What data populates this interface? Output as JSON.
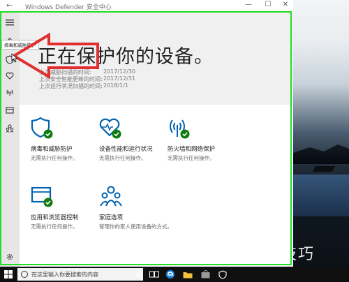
{
  "window": {
    "title": "Windows Defender 安全中心",
    "back_glyph": "←",
    "minimize_glyph": "—",
    "maximize_glyph": "☐",
    "close_glyph": "✕"
  },
  "tooltip": "病毒和威胁防护",
  "hero": {
    "title": "正在保护你的设备。",
    "lines": [
      {
        "label": "上次威胁扫描的时间:",
        "date": "2017/12/30"
      },
      {
        "label": "上次安全智能更新的时间:",
        "date": "2017/12/31"
      },
      {
        "label": "上次运行状况扫描的时间:",
        "date": "2018/1/1"
      }
    ]
  },
  "tiles": [
    {
      "icon": "shield-check-icon",
      "name": "病毒和威胁防护",
      "status": "无需执行任何操作。"
    },
    {
      "icon": "heart-check-icon",
      "name": "设备性能和运行状况",
      "status": "无需执行任何操作。"
    },
    {
      "icon": "wifi-check-icon",
      "name": "防火墙和网络保护",
      "status": "无需执行任何操作。"
    },
    {
      "icon": "browser-check-icon",
      "name": "应用和浏览器控制",
      "status": "无需执行任何操作。"
    },
    {
      "icon": "family-icon",
      "name": "家庭选项",
      "status": "管理你的家人使用设备的方式。"
    }
  ],
  "taskbar": {
    "search_placeholder": "在这里输入你要搜索的内容"
  },
  "watermark": "软件技巧",
  "colors": {
    "accent": "#0063b1",
    "check_green": "#107c10",
    "highlight": "#22dd22",
    "arrow": "#e03030"
  }
}
